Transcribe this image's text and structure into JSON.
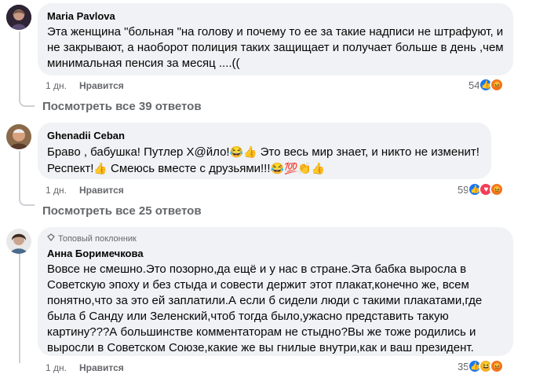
{
  "comments": [
    {
      "author": "Maria Pavlova",
      "text": "Эта женщина \"больная \"на голову и почему то ее за такие надписи не штрафуют, и не закрывают, а наоборот полиция таких защищает и получает больше в день ,чем минимальная пенсия за месяц ....((",
      "time": "1 дн.",
      "like_label": "Нравится",
      "reaction_count": "54",
      "reactions": [
        "like-icon",
        "angry-icon"
      ],
      "view_replies": "Посмотреть все 39 ответов"
    },
    {
      "author": "Ghenadii Ceban",
      "text_line1": "Браво , бабушка! Путлер Х@йло!",
      "text_line1_emoji": "😂👍",
      "text_line1_rest": " Это весь мир знает, и никто не изменит!",
      "text_line2": "Респект!",
      "text_line2_emoji1": "👍",
      "text_line2_mid": " Смеюсь вместе с друзьями!!!",
      "text_line2_emoji2": "😂💯👏👍",
      "time": "1 дн.",
      "like_label": "Нравится",
      "reaction_count": "59",
      "reactions": [
        "like-icon",
        "love-icon",
        "angry-icon"
      ],
      "view_replies": "Посмотреть все 25 ответов"
    },
    {
      "badge": "Топовый поклонник",
      "author": "Анна Боримечкова",
      "text": "Вовсе не смешно.Это позорно,да ещё и у нас в стране.Эта бабка выросла в Советскую эпоху и без стыда и совести держит этот плакат,конечно же, всем понятно,что за это ей заплатили.А если б сидели люди с такими плакатами,где была б Санду или Зеленский,чтоб тогда было,ужасно представить такую картину???А большинстве комментаторам не стыдно?Вы же тоже родились и выросли в Советском Союзе,какие же вы гнилые внутри,как и ваш президент.",
      "time": "1 дн.",
      "like_label": "Нравится",
      "reaction_count": "35",
      "reactions": [
        "like-icon",
        "haha-icon",
        "angry-icon"
      ]
    }
  ]
}
